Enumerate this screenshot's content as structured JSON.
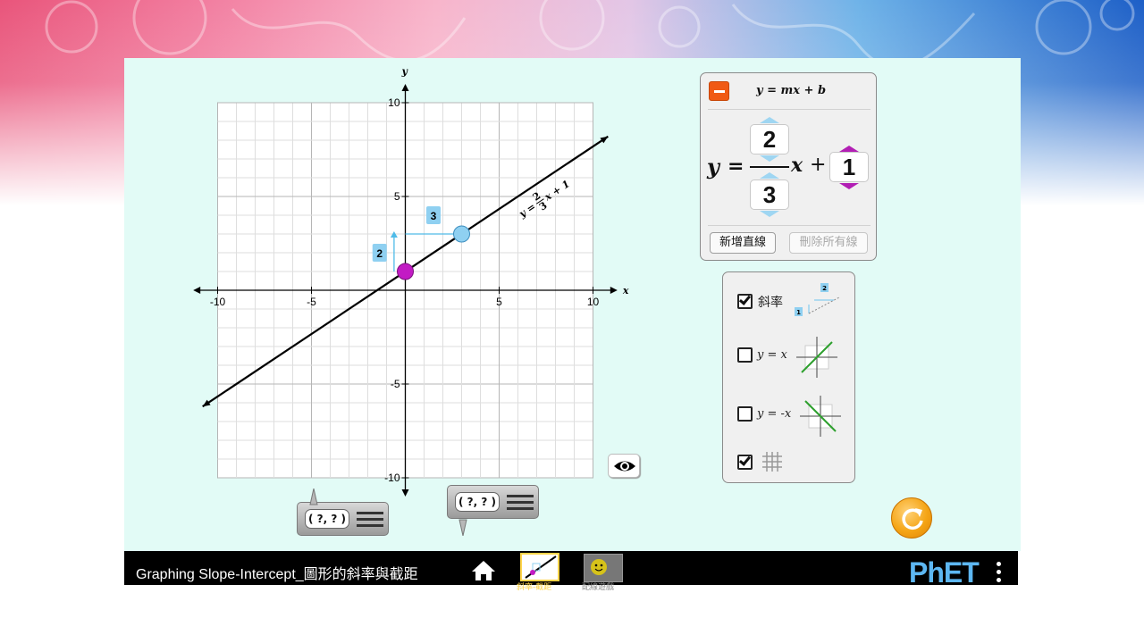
{
  "app": {
    "title": "Graphing Slope-Intercept_圖形的斜率與截距",
    "logo": "PhET"
  },
  "graph": {
    "x_axis_label": "x",
    "y_axis_label": "y",
    "x_ticks": [
      "-10",
      "-5",
      "5",
      "10"
    ],
    "y_ticks": [
      "10",
      "5",
      "-5",
      "-10"
    ],
    "range": [
      -10,
      10
    ],
    "line_color": "#000000",
    "slope_rise_label": "2",
    "slope_run_label": "3",
    "line_equation": {
      "y": "y",
      "eq": "=",
      "num": "2",
      "den": "3",
      "tail": "x + 1"
    },
    "intercept_point_color": "#c21bc4",
    "slope_point_color": "#8fd0f1"
  },
  "equation_panel": {
    "form": "y = mx + b",
    "y": "y",
    "equals": "=",
    "rise": "2",
    "run": "3",
    "x": "x",
    "plus": "+",
    "intercept": "1",
    "save_label": "新增直線",
    "erase_label": "刪除所有線"
  },
  "options": {
    "slope_label": "斜率",
    "slope_checked": true,
    "y_eq_x_label": "y = x",
    "y_eq_x_checked": false,
    "y_eq_neg_x_label": "y = -x",
    "y_eq_neg_x_checked": false,
    "grid_checked": true,
    "slope_icon_rise": "2",
    "slope_icon_run": "1"
  },
  "point_tools": [
    {
      "label": "( ?, ? )"
    },
    {
      "label": "( ?, ? )"
    }
  ],
  "nav": {
    "screen1_label": "斜率-截距",
    "screen2_label": "配線遊戲"
  }
}
